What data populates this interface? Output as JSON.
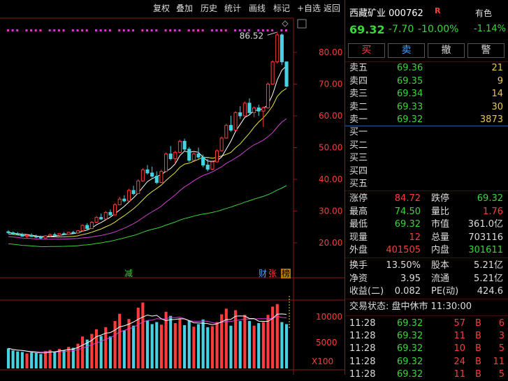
{
  "toolbar": {
    "items": [
      "复权",
      "叠加",
      "历史",
      "统计",
      "画线",
      "标记",
      "+自选",
      "返回"
    ]
  },
  "chart": {
    "price_ticks": [
      "80.00",
      "70.00",
      "60.00",
      "50.00",
      "40.00",
      "30.00",
      "20.00"
    ],
    "max_label": "86.52",
    "volume_ticks": [
      "10000",
      "5000"
    ],
    "volume_unit": "X100",
    "markers": {
      "jian": "减",
      "cai": "财",
      "zhang": "张",
      "bang": "榜"
    },
    "colors": {
      "up": "#ff3b3b",
      "down": "#46d2e0",
      "ma5": "#ffffff",
      "ma10": "#e8e840",
      "ma20": "#d040d0",
      "ma60": "#3fcf3f"
    }
  },
  "chart_data": {
    "type": "candlestick",
    "ylim": [
      15,
      88
    ],
    "candles_ohlc": [
      [
        23.5,
        24.0,
        22.8,
        23.2
      ],
      [
        23.2,
        23.6,
        22.5,
        22.9
      ],
      [
        22.9,
        23.4,
        22.3,
        22.6
      ],
      [
        22.6,
        23.2,
        21.9,
        22.1
      ],
      [
        22.1,
        22.8,
        21.6,
        22.4
      ],
      [
        22.4,
        23.0,
        21.8,
        22.0
      ],
      [
        22.0,
        22.6,
        21.5,
        21.8
      ],
      [
        21.8,
        22.3,
        21.2,
        21.5
      ],
      [
        21.5,
        22.4,
        21.3,
        22.2
      ],
      [
        22.2,
        22.9,
        21.8,
        22.6
      ],
      [
        22.6,
        23.2,
        22.1,
        22.4
      ],
      [
        22.4,
        23.0,
        22.0,
        22.9
      ],
      [
        22.9,
        23.4,
        22.4,
        22.7
      ],
      [
        22.7,
        23.5,
        22.5,
        23.3
      ],
      [
        23.3,
        23.8,
        22.9,
        23.1
      ],
      [
        23.1,
        24.0,
        22.9,
        23.8
      ],
      [
        23.8,
        25.8,
        23.6,
        25.5
      ],
      [
        25.5,
        26.2,
        24.2,
        24.5
      ],
      [
        24.5,
        26.8,
        24.3,
        26.5
      ],
      [
        26.5,
        28.5,
        26.2,
        28.0
      ],
      [
        28.0,
        29.2,
        27.2,
        27.5
      ],
      [
        27.5,
        30.0,
        27.3,
        29.6
      ],
      [
        29.6,
        30.5,
        28.4,
        28.8
      ],
      [
        28.8,
        32.5,
        28.6,
        32.0
      ],
      [
        32.0,
        34.5,
        31.8,
        33.8
      ],
      [
        33.8,
        35.0,
        32.8,
        33.2
      ],
      [
        33.2,
        37.0,
        33.0,
        36.5
      ],
      [
        36.5,
        38.0,
        35.0,
        35.5
      ],
      [
        35.5,
        40.0,
        35.4,
        39.5
      ],
      [
        39.5,
        43.5,
        39.2,
        43.0
      ],
      [
        43.0,
        44.5,
        41.5,
        42.0
      ],
      [
        42.0,
        44.0,
        40.5,
        41.0
      ],
      [
        41.0,
        42.5,
        38.5,
        39.0
      ],
      [
        39.0,
        43.0,
        38.8,
        42.5
      ],
      [
        42.5,
        48.5,
        42.3,
        48.0
      ],
      [
        48.0,
        50.5,
        46.0,
        46.5
      ],
      [
        46.5,
        49.0,
        45.0,
        48.5
      ],
      [
        48.5,
        52.5,
        48.3,
        52.0
      ],
      [
        52.0,
        52.8,
        49.0,
        49.5
      ],
      [
        49.5,
        50.2,
        45.5,
        46.0
      ],
      [
        46.0,
        48.5,
        45.8,
        48.0
      ],
      [
        48.0,
        50.0,
        46.5,
        47.0
      ],
      [
        47.0,
        47.8,
        43.8,
        44.5
      ],
      [
        44.5,
        46.5,
        42.5,
        43.2
      ],
      [
        43.2,
        46.0,
        42.8,
        45.5
      ],
      [
        45.5,
        49.5,
        45.3,
        49.0
      ],
      [
        49.0,
        53.5,
        48.8,
        53.0
      ],
      [
        53.0,
        57.5,
        52.8,
        57.0
      ],
      [
        57.0,
        60.0,
        55.0,
        55.5
      ],
      [
        55.5,
        61.5,
        55.3,
        61.0
      ],
      [
        61.0,
        63.0,
        59.0,
        60.0
      ],
      [
        60.0,
        64.5,
        59.8,
        64.0
      ],
      [
        64.0,
        65.5,
        60.5,
        61.0
      ],
      [
        61.0,
        63.0,
        59.5,
        62.5
      ],
      [
        62.5,
        63.5,
        60.0,
        61.5
      ],
      [
        61.5,
        63.0,
        56.5,
        62.5
      ],
      [
        62.5,
        70.5,
        62.3,
        70.0
      ],
      [
        70.0,
        77.5,
        69.8,
        77.0
      ],
      [
        77.0,
        86.52,
        76.5,
        85.5
      ],
      [
        85.5,
        86.0,
        76.0,
        77.0
      ],
      [
        77.0,
        73.5,
        69.0,
        69.32
      ]
    ],
    "volume_range": [
      0,
      13000
    ]
  },
  "stock": {
    "name_code": "西藏矿业 000762",
    "r_badge": "R",
    "sector": "有色",
    "price": "69.32",
    "change": "-7.70",
    "change_pct": "-10.00%",
    "sector_pct": "-1.14%"
  },
  "actions": [
    {
      "label": "买",
      "color": "#ff3b3b"
    },
    {
      "label": "卖",
      "color": "#46a6ff"
    },
    {
      "label": "撤",
      "color": "#dddddd"
    },
    {
      "label": "警",
      "color": "#dddddd"
    }
  ],
  "asks": [
    {
      "label": "卖五",
      "price": "69.36",
      "vol": "21"
    },
    {
      "label": "卖四",
      "price": "69.35",
      "vol": "9"
    },
    {
      "label": "卖三",
      "price": "69.34",
      "vol": "14"
    },
    {
      "label": "卖二",
      "price": "69.33",
      "vol": "30"
    },
    {
      "label": "卖一",
      "price": "69.32",
      "vol": "3873"
    }
  ],
  "bids": [
    {
      "label": "买一",
      "price": "",
      "vol": ""
    },
    {
      "label": "买二",
      "price": "",
      "vol": ""
    },
    {
      "label": "买三",
      "price": "",
      "vol": ""
    },
    {
      "label": "买四",
      "price": "",
      "vol": ""
    },
    {
      "label": "买五",
      "price": "",
      "vol": ""
    }
  ],
  "stats1": [
    {
      "l1": "涨停",
      "v1": "84.72",
      "c1": "r",
      "l2": "跌停",
      "v2": "69.32",
      "c2": "g"
    },
    {
      "l1": "最高",
      "v1": "74.50",
      "c1": "g",
      "l2": "量比",
      "v2": "1.76",
      "c2": "r"
    },
    {
      "l1": "最低",
      "v1": "69.32",
      "c1": "g",
      "l2": "市值",
      "v2": "361.0亿",
      "c2": "w"
    },
    {
      "l1": "现量",
      "v1": "12",
      "c1": "r",
      "l2": "总量",
      "v2": "703116",
      "c2": "w"
    },
    {
      "l1": "外盘",
      "v1": "401505",
      "c1": "r",
      "l2": "内盘",
      "v2": "301611",
      "c2": "g"
    }
  ],
  "stats2": [
    {
      "l1": "换手",
      "v1": "13.50%",
      "l2": "股本",
      "v2": "5.21亿"
    },
    {
      "l1": "净资",
      "v1": "3.95",
      "l2": "流通",
      "v2": "5.21亿"
    },
    {
      "l1": "收益(二)",
      "v1": "0.082",
      "l2": "PE(动)",
      "v2": "424.6"
    }
  ],
  "status": "交易状态: 盘中休市 11:30:00",
  "ticks": [
    {
      "time": "11:28",
      "price": "69.32",
      "vol": "57",
      "side": "B",
      "count": "6"
    },
    {
      "time": "11:28",
      "price": "69.32",
      "vol": "11",
      "side": "B",
      "count": "3"
    },
    {
      "time": "11:28",
      "price": "69.32",
      "vol": "10",
      "side": "B",
      "count": "5"
    },
    {
      "time": "11:28",
      "price": "69.32",
      "vol": "24",
      "side": "B",
      "count": "11"
    },
    {
      "time": "11:28",
      "price": "69.32",
      "vol": "11",
      "side": "B",
      "count": "5"
    }
  ]
}
